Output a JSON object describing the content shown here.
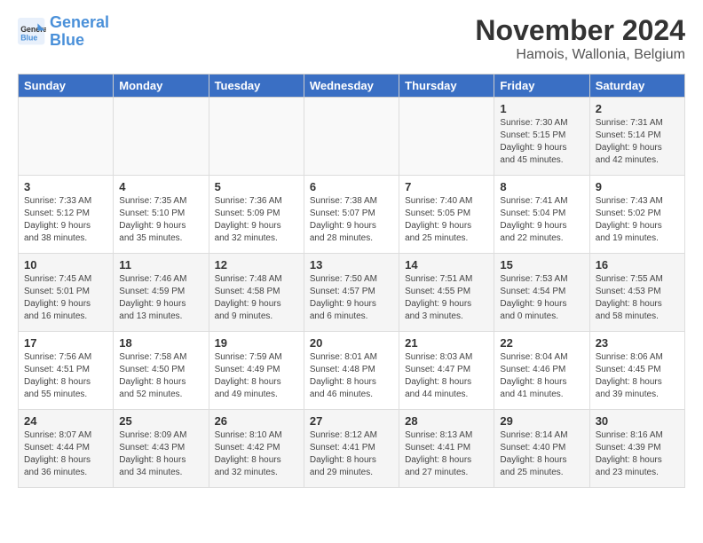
{
  "logo": {
    "line1": "General",
    "line2": "Blue"
  },
  "title": "November 2024",
  "location": "Hamois, Wallonia, Belgium",
  "days_of_week": [
    "Sunday",
    "Monday",
    "Tuesday",
    "Wednesday",
    "Thursday",
    "Friday",
    "Saturday"
  ],
  "weeks": [
    [
      {
        "day": "",
        "info": ""
      },
      {
        "day": "",
        "info": ""
      },
      {
        "day": "",
        "info": ""
      },
      {
        "day": "",
        "info": ""
      },
      {
        "day": "",
        "info": ""
      },
      {
        "day": "1",
        "info": "Sunrise: 7:30 AM\nSunset: 5:15 PM\nDaylight: 9 hours\nand 45 minutes."
      },
      {
        "day": "2",
        "info": "Sunrise: 7:31 AM\nSunset: 5:14 PM\nDaylight: 9 hours\nand 42 minutes."
      }
    ],
    [
      {
        "day": "3",
        "info": "Sunrise: 7:33 AM\nSunset: 5:12 PM\nDaylight: 9 hours\nand 38 minutes."
      },
      {
        "day": "4",
        "info": "Sunrise: 7:35 AM\nSunset: 5:10 PM\nDaylight: 9 hours\nand 35 minutes."
      },
      {
        "day": "5",
        "info": "Sunrise: 7:36 AM\nSunset: 5:09 PM\nDaylight: 9 hours\nand 32 minutes."
      },
      {
        "day": "6",
        "info": "Sunrise: 7:38 AM\nSunset: 5:07 PM\nDaylight: 9 hours\nand 28 minutes."
      },
      {
        "day": "7",
        "info": "Sunrise: 7:40 AM\nSunset: 5:05 PM\nDaylight: 9 hours\nand 25 minutes."
      },
      {
        "day": "8",
        "info": "Sunrise: 7:41 AM\nSunset: 5:04 PM\nDaylight: 9 hours\nand 22 minutes."
      },
      {
        "day": "9",
        "info": "Sunrise: 7:43 AM\nSunset: 5:02 PM\nDaylight: 9 hours\nand 19 minutes."
      }
    ],
    [
      {
        "day": "10",
        "info": "Sunrise: 7:45 AM\nSunset: 5:01 PM\nDaylight: 9 hours\nand 16 minutes."
      },
      {
        "day": "11",
        "info": "Sunrise: 7:46 AM\nSunset: 4:59 PM\nDaylight: 9 hours\nand 13 minutes."
      },
      {
        "day": "12",
        "info": "Sunrise: 7:48 AM\nSunset: 4:58 PM\nDaylight: 9 hours\nand 9 minutes."
      },
      {
        "day": "13",
        "info": "Sunrise: 7:50 AM\nSunset: 4:57 PM\nDaylight: 9 hours\nand 6 minutes."
      },
      {
        "day": "14",
        "info": "Sunrise: 7:51 AM\nSunset: 4:55 PM\nDaylight: 9 hours\nand 3 minutes."
      },
      {
        "day": "15",
        "info": "Sunrise: 7:53 AM\nSunset: 4:54 PM\nDaylight: 9 hours\nand 0 minutes."
      },
      {
        "day": "16",
        "info": "Sunrise: 7:55 AM\nSunset: 4:53 PM\nDaylight: 8 hours\nand 58 minutes."
      }
    ],
    [
      {
        "day": "17",
        "info": "Sunrise: 7:56 AM\nSunset: 4:51 PM\nDaylight: 8 hours\nand 55 minutes."
      },
      {
        "day": "18",
        "info": "Sunrise: 7:58 AM\nSunset: 4:50 PM\nDaylight: 8 hours\nand 52 minutes."
      },
      {
        "day": "19",
        "info": "Sunrise: 7:59 AM\nSunset: 4:49 PM\nDaylight: 8 hours\nand 49 minutes."
      },
      {
        "day": "20",
        "info": "Sunrise: 8:01 AM\nSunset: 4:48 PM\nDaylight: 8 hours\nand 46 minutes."
      },
      {
        "day": "21",
        "info": "Sunrise: 8:03 AM\nSunset: 4:47 PM\nDaylight: 8 hours\nand 44 minutes."
      },
      {
        "day": "22",
        "info": "Sunrise: 8:04 AM\nSunset: 4:46 PM\nDaylight: 8 hours\nand 41 minutes."
      },
      {
        "day": "23",
        "info": "Sunrise: 8:06 AM\nSunset: 4:45 PM\nDaylight: 8 hours\nand 39 minutes."
      }
    ],
    [
      {
        "day": "24",
        "info": "Sunrise: 8:07 AM\nSunset: 4:44 PM\nDaylight: 8 hours\nand 36 minutes."
      },
      {
        "day": "25",
        "info": "Sunrise: 8:09 AM\nSunset: 4:43 PM\nDaylight: 8 hours\nand 34 minutes."
      },
      {
        "day": "26",
        "info": "Sunrise: 8:10 AM\nSunset: 4:42 PM\nDaylight: 8 hours\nand 32 minutes."
      },
      {
        "day": "27",
        "info": "Sunrise: 8:12 AM\nSunset: 4:41 PM\nDaylight: 8 hours\nand 29 minutes."
      },
      {
        "day": "28",
        "info": "Sunrise: 8:13 AM\nSunset: 4:41 PM\nDaylight: 8 hours\nand 27 minutes."
      },
      {
        "day": "29",
        "info": "Sunrise: 8:14 AM\nSunset: 4:40 PM\nDaylight: 8 hours\nand 25 minutes."
      },
      {
        "day": "30",
        "info": "Sunrise: 8:16 AM\nSunset: 4:39 PM\nDaylight: 8 hours\nand 23 minutes."
      }
    ]
  ]
}
